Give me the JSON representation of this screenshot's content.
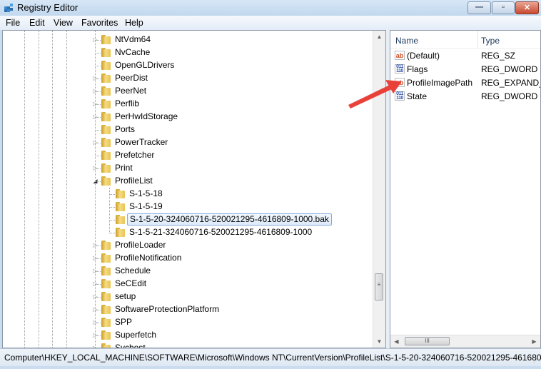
{
  "window": {
    "title": "Registry Editor",
    "controls": {
      "minimize": "—",
      "maximize": "▫",
      "close": "✕"
    }
  },
  "menu": [
    "File",
    "Edit",
    "View",
    "Favorites",
    "Help"
  ],
  "tree": {
    "nodes": [
      {
        "label": "NtVdm64",
        "expander": "collapsed",
        "level": 0
      },
      {
        "label": "NvCache",
        "expander": "none",
        "level": 0
      },
      {
        "label": "OpenGLDrivers",
        "expander": "none",
        "level": 0
      },
      {
        "label": "PeerDist",
        "expander": "collapsed",
        "level": 0
      },
      {
        "label": "PeerNet",
        "expander": "collapsed",
        "level": 0
      },
      {
        "label": "Perflib",
        "expander": "collapsed",
        "level": 0
      },
      {
        "label": "PerHwIdStorage",
        "expander": "collapsed",
        "level": 0
      },
      {
        "label": "Ports",
        "expander": "none",
        "level": 0
      },
      {
        "label": "PowerTracker",
        "expander": "collapsed",
        "level": 0
      },
      {
        "label": "Prefetcher",
        "expander": "none",
        "level": 0
      },
      {
        "label": "Print",
        "expander": "collapsed",
        "level": 0
      },
      {
        "label": "ProfileList",
        "expander": "expanded",
        "level": 0
      },
      {
        "label": "S-1-5-18",
        "expander": "none",
        "level": 1
      },
      {
        "label": "S-1-5-19",
        "expander": "none",
        "level": 1
      },
      {
        "label": "S-1-5-20-324060716-520021295-4616809-1000.bak",
        "expander": "none",
        "level": 1,
        "selected": true
      },
      {
        "label": "S-1-5-21-324060716-520021295-4616809-1000",
        "expander": "none",
        "level": 1
      },
      {
        "label": "ProfileLoader",
        "expander": "collapsed",
        "level": 0
      },
      {
        "label": "ProfileNotification",
        "expander": "collapsed",
        "level": 0
      },
      {
        "label": "Schedule",
        "expander": "collapsed",
        "level": 0
      },
      {
        "label": "SeCEdit",
        "expander": "collapsed",
        "level": 0
      },
      {
        "label": "setup",
        "expander": "collapsed",
        "level": 0
      },
      {
        "label": "SoftwareProtectionPlatform",
        "expander": "collapsed",
        "level": 0
      },
      {
        "label": "SPP",
        "expander": "collapsed",
        "level": 0
      },
      {
        "label": "Superfetch",
        "expander": "collapsed",
        "level": 0
      },
      {
        "label": "Svchost",
        "expander": "collapsed",
        "level": 0
      }
    ]
  },
  "values": {
    "columns": {
      "name": "Name",
      "type": "Type"
    },
    "rows": [
      {
        "icon": "string-value-icon",
        "glyph": "ab",
        "name": "(Default)",
        "type": "REG_SZ"
      },
      {
        "icon": "binary-value-icon",
        "glyph": "011 110",
        "name": "Flags",
        "type": "REG_DWORD"
      },
      {
        "icon": "string-value-icon",
        "glyph": "ab",
        "name": "ProfileImagePath",
        "type": "REG_EXPAND_SZ"
      },
      {
        "icon": "binary-value-icon",
        "glyph": "011 110",
        "name": "State",
        "type": "REG_DWORD"
      }
    ]
  },
  "scroll": {
    "up": "▲",
    "down": "▼",
    "left": "◀",
    "right": "▶",
    "grip": "≡",
    "hgrip": "III"
  },
  "status": {
    "path": "Computer\\HKEY_LOCAL_MACHINE\\SOFTWARE\\Microsoft\\Windows NT\\CurrentVersion\\ProfileList\\S-1-5-20-324060716-520021295-461680"
  },
  "annotation": {
    "color": "#e8413a",
    "target": "ProfileImagePath"
  }
}
